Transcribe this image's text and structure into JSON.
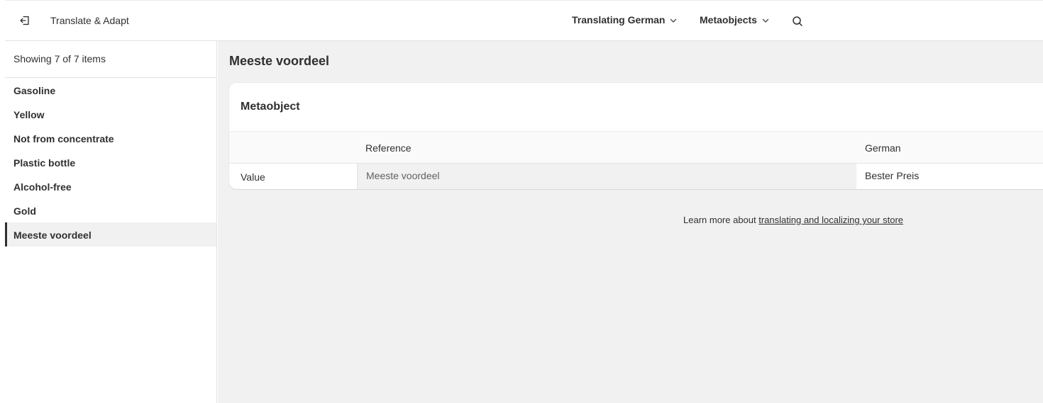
{
  "topbar": {
    "app_title": "Translate & Adapt",
    "language_dropdown": "Translating German",
    "resource_dropdown": "Metaobjects",
    "icons": {
      "exit": "exit-icon",
      "search": "search-icon",
      "chevron": "chevron-down-icon"
    }
  },
  "sidebar": {
    "count_text": "Showing 7 of 7 items",
    "items": [
      {
        "label": "Gasoline"
      },
      {
        "label": "Yellow"
      },
      {
        "label": "Not from concentrate"
      },
      {
        "label": "Plastic bottle"
      },
      {
        "label": "Alcohol-free"
      },
      {
        "label": "Gold"
      },
      {
        "label": "Meeste voordeel",
        "active": true
      }
    ]
  },
  "main": {
    "page_title": "Meeste voordeel",
    "card": {
      "title": "Metaobject",
      "columns": {
        "reference": "Reference",
        "german": "German"
      },
      "rows": [
        {
          "label": "Value",
          "reference": "Meeste voordeel",
          "translation": "Bester Preis"
        }
      ]
    },
    "footer": {
      "prefix": "Learn more about ",
      "link_text": "translating and localizing your store"
    }
  },
  "colors": {
    "text": "#303030",
    "muted": "#616161",
    "canvas": "#f1f1f1",
    "border": "#e3e3e3"
  }
}
